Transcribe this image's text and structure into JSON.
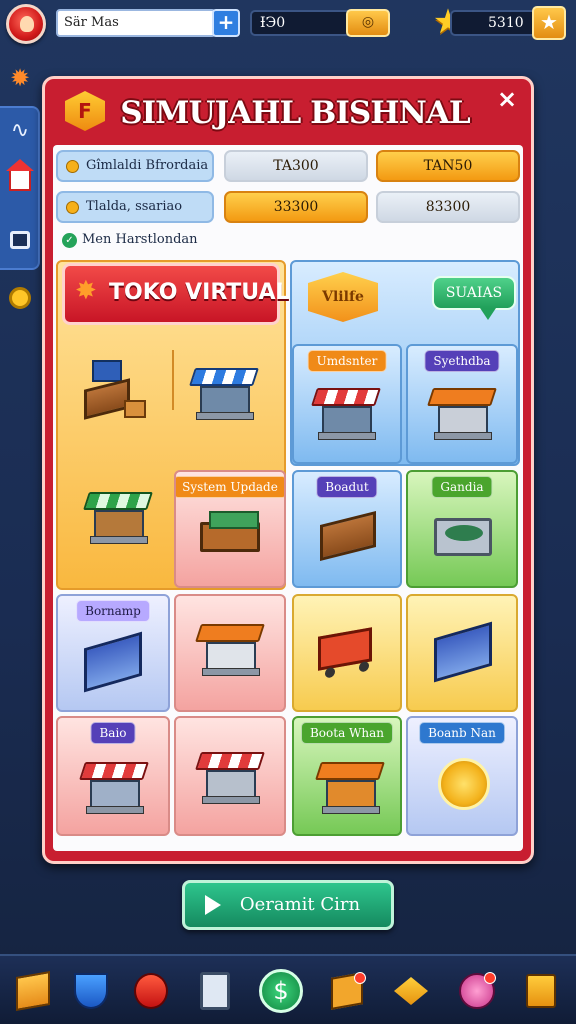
{
  "topbar": {
    "search_value": "Sär Mas",
    "plus_label": "+",
    "coins_value": "ƗЭ0",
    "coin_icon": "◎",
    "stars_value": "5310",
    "star_icon": "★"
  },
  "panel": {
    "logo_letter": "F",
    "title": "SIMUJAHL BISHNAL",
    "close_label": "×",
    "stats": [
      {
        "label": "Gîmlaldi Bfrordaia",
        "box_a": "TA300",
        "box_b": "TAN50"
      },
      {
        "label": "Tlalda, ssariao",
        "box_a": "33300",
        "box_b": "83300"
      }
    ],
    "check_label": "Men Harstlondan",
    "banner": "TOKO VIRTUAL",
    "villa_badge": "Vlilfe",
    "sunias_bubble": "SUAIAS",
    "tiles": {
      "umdsnter": "Umdsnter",
      "syethdba": "Syethdba",
      "system_update": "System Updade",
      "boadut": "Boadut",
      "gandia": "Gandia",
      "bornamp": "Bornamp",
      "baio": "Baio",
      "boota_whan": "Boota Whan",
      "boanb_nan": "Boanb Nan"
    }
  },
  "cta": {
    "label": "Oeramit Cirn"
  },
  "bottom_nav": [
    "box",
    "shield",
    "red-shield",
    "card",
    "center",
    "crate",
    "chevron",
    "pink",
    "list"
  ],
  "colors": {
    "panel_red": "#c81e30",
    "accent_orange": "#f39a12",
    "cta_green": "#158a5f"
  }
}
